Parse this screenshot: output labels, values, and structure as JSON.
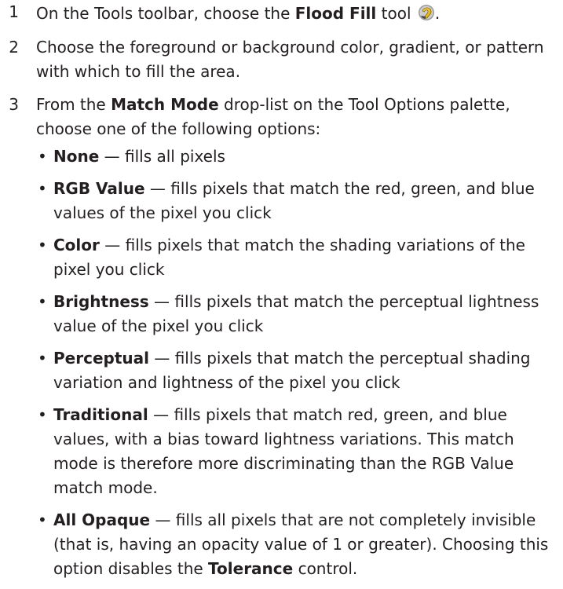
{
  "steps": [
    {
      "number": "1",
      "pre": "On the Tools toolbar, choose the ",
      "bold": "Flood Fill",
      "post": " tool",
      "icon": "flood-fill-tool-icon",
      "end": "."
    },
    {
      "number": "2",
      "text": "Choose the foreground or background color, gradient, or pattern with which to fill the area."
    },
    {
      "number": "3",
      "pre": "From the ",
      "bold": "Match Mode",
      "post": " drop-list on the Tool Options palette, choose one of the following options:"
    }
  ],
  "options": [
    {
      "name": "None",
      "desc": " — fills all pixels"
    },
    {
      "name": "RGB Value",
      "desc": " — fills pixels that match the red, green, and blue values of the pixel you click"
    },
    {
      "name": "Color",
      "desc": " — fills pixels that match the shading variations of the pixel you click"
    },
    {
      "name": "Brightness",
      "desc": " — fills pixels that match the perceptual lightness value of the pixel you click"
    },
    {
      "name": "Perceptual",
      "desc": " — fills pixels that match the perceptual shading variation and lightness of the pixel you click"
    },
    {
      "name": "Traditional",
      "desc": " — fills pixels that match red, green, and blue values, with a bias toward lightness variations. This match mode is therefore more discriminating than the RGB Value match mode."
    },
    {
      "name": "All Opaque",
      "desc": " — fills all pixels that are not completely invisible (that is, having an opacity value of 1 or greater). Choosing this option disables the ",
      "bold2": "Tolerance",
      "desc2": " control."
    }
  ],
  "bullet": "•"
}
